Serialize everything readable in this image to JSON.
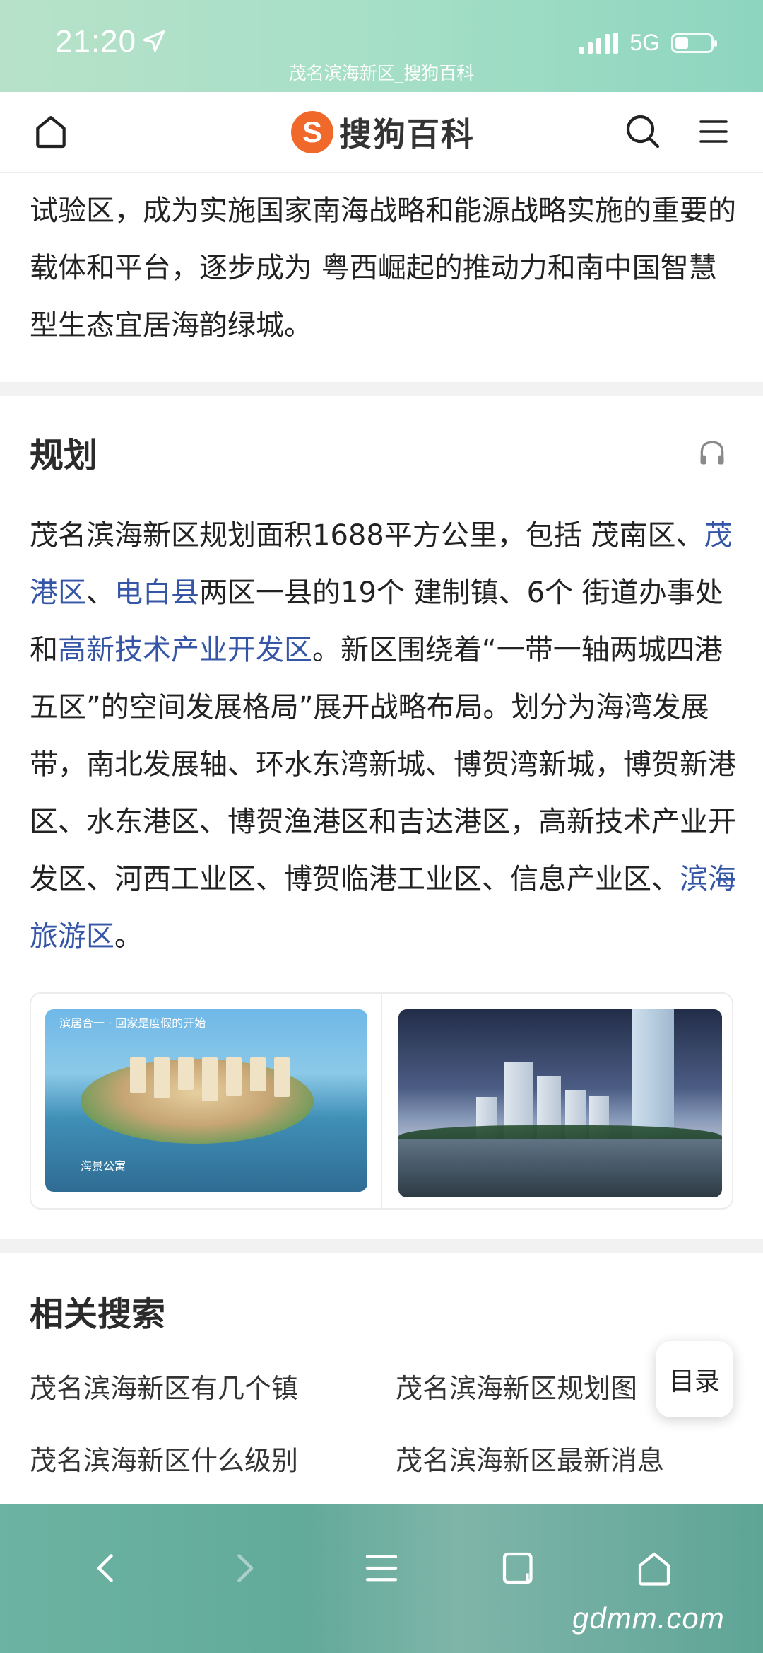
{
  "status_bar": {
    "time": "21:20",
    "network": "5G",
    "page_url_title": "茂名滨海新区_搜狗百科"
  },
  "header": {
    "logo_mark": "S",
    "logo_text": "搜狗百科"
  },
  "intro": {
    "text": "试验区，成为实施国家南海战略和能源战略实施的重要的载体和平台，逐步成为 粤西崛起的推动力和南中国智慧型生态宜居海韵绿城。"
  },
  "planning": {
    "title": "规划",
    "p1": "茂名滨海新区规划面积1688平方公里，包括 茂南区、",
    "link1": "茂港区",
    "p2": "、",
    "link2": "电白县",
    "p3": "两区一县的19个 建制镇、6个 街道办事处和",
    "link3": "高新技术产业开发区",
    "p4": "。新区围绕着“一带一轴两城四港五区”的空间发展格局”展开战略布局。划分为海湾发展带，南北发展轴、环水东湾新城、博贺湾新城，博贺新港区、水东港区、博贺渔港区和吉达港区，高新技术产业开发区、河西工业区、博贺临港工业区、信息产业区、",
    "link4": "滨海旅游区",
    "p5": "。"
  },
  "gallery": {
    "image1_caption_top": "滨居合一 · 回家是度假的开始",
    "image1_caption_bottom": "海景公寓"
  },
  "related": {
    "title": "相关搜索",
    "items": [
      "茂名滨海新区有几个镇",
      "茂名滨海新区规划图",
      "茂名滨海新区什么级别",
      "茂名滨海新区最新消息"
    ]
  },
  "toc_button": "目录",
  "watermark": "gdmm.com",
  "colors": {
    "link": "#3556a6",
    "logo_orange": "#f1692a",
    "status_bar_green": "#a6dfc7",
    "toolbar_green": "#62aa99"
  }
}
